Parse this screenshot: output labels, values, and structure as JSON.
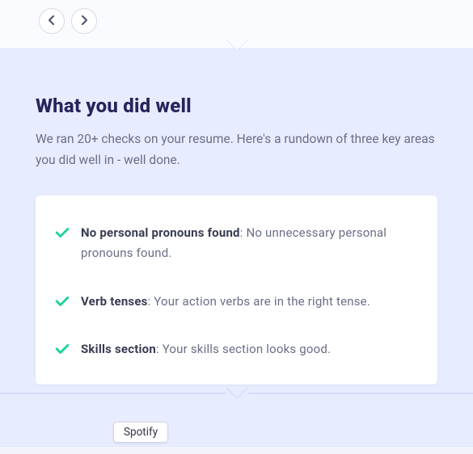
{
  "nav": {
    "prev_label": "Previous",
    "next_label": "Next"
  },
  "section": {
    "title": "What you did well",
    "subtitle": "We ran 20+ checks on your resume. Here's a rundown of three key areas you did well in - well done."
  },
  "checks": [
    {
      "title": "No personal pronouns found",
      "desc": ": No unnecessary personal pronouns found."
    },
    {
      "title": "Verb tenses",
      "desc": ": Your action verbs are in the right tense."
    },
    {
      "title": "Skills section",
      "desc": ": Your skills section looks good."
    }
  ],
  "tooltip": {
    "label": "Spotify"
  },
  "colors": {
    "accent_check": "#21d19f",
    "heading": "#29235c"
  }
}
